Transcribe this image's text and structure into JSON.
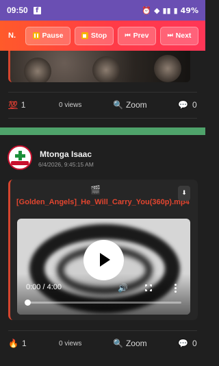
{
  "status_bar": {
    "time": "09:50",
    "app_icon": "facebook-icon",
    "battery": "49%",
    "icons": [
      "alarm-icon",
      "wifi-icon",
      "signal-icon",
      "battery-icon"
    ]
  },
  "controls": {
    "short_title": "N.",
    "pause_label": "Pause",
    "stop_label": "Stop",
    "prev_label": "Prev",
    "next_label": "Next",
    "prev_glyph": "⏮",
    "next_glyph": "⏭"
  },
  "posts": [
    {
      "reaction_emoji": "💯",
      "reaction_count": "1",
      "views": "0 views",
      "zoom_label": "Zoom",
      "comment_count": "0"
    },
    {
      "author": "Mtonga Isaac",
      "timestamp": "6/4/2026, 9:45:15 AM",
      "clapper_icon": "🎬",
      "file_name": "[Golden_Angels]_He_Will_Carry_You(360p).mp4",
      "player": {
        "time": "0:00 / 4:00",
        "progress": 0.0
      },
      "reaction_emoji": "🔥",
      "reaction_count": "1",
      "views": "0 views",
      "zoom_label": "Zoom",
      "comment_count": "0"
    }
  ],
  "colors": {
    "accent": "#e2452f",
    "separator": "#4fa36b",
    "statusbar": "#6a4fb3"
  }
}
